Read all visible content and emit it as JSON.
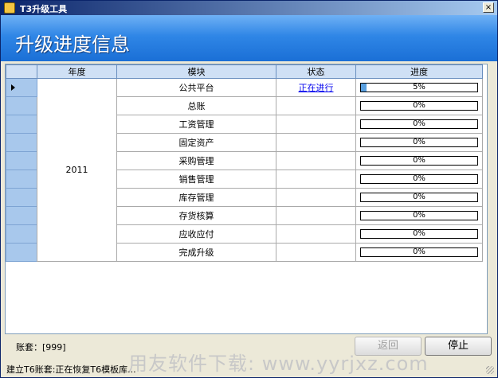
{
  "window": {
    "title": "T3升级工具",
    "close_glyph": "×"
  },
  "banner": {
    "title": "升级进度信息"
  },
  "grid": {
    "headers": {
      "year": "年度",
      "module": "模块",
      "status": "状态",
      "progress": "进度"
    },
    "year": "2011",
    "rows": [
      {
        "module": "公共平台",
        "status": "正在进行",
        "progress": 5,
        "progress_label": "5%"
      },
      {
        "module": "总账",
        "status": "",
        "progress": 0,
        "progress_label": "0%"
      },
      {
        "module": "工资管理",
        "status": "",
        "progress": 0,
        "progress_label": "0%"
      },
      {
        "module": "固定资产",
        "status": "",
        "progress": 0,
        "progress_label": "0%"
      },
      {
        "module": "采购管理",
        "status": "",
        "progress": 0,
        "progress_label": "0%"
      },
      {
        "module": "销售管理",
        "status": "",
        "progress": 0,
        "progress_label": "0%"
      },
      {
        "module": "库存管理",
        "status": "",
        "progress": 0,
        "progress_label": "0%"
      },
      {
        "module": "存货核算",
        "status": "",
        "progress": 0,
        "progress_label": "0%"
      },
      {
        "module": "应收应付",
        "status": "",
        "progress": 0,
        "progress_label": "0%"
      },
      {
        "module": "完成升级",
        "status": "",
        "progress": 0,
        "progress_label": "0%"
      }
    ]
  },
  "footer": {
    "account": "账套：[999]",
    "back_label": "返回",
    "stop_label": "停止",
    "status_text": "建立T6账套:正在恢复T6模板库...",
    "watermark": "用友软件下载: www.yyrjxz.com"
  },
  "colors": {
    "banner": "#2f86e6",
    "row_header": "#a8c8ec",
    "progress_fill": "#5aa0e0"
  }
}
